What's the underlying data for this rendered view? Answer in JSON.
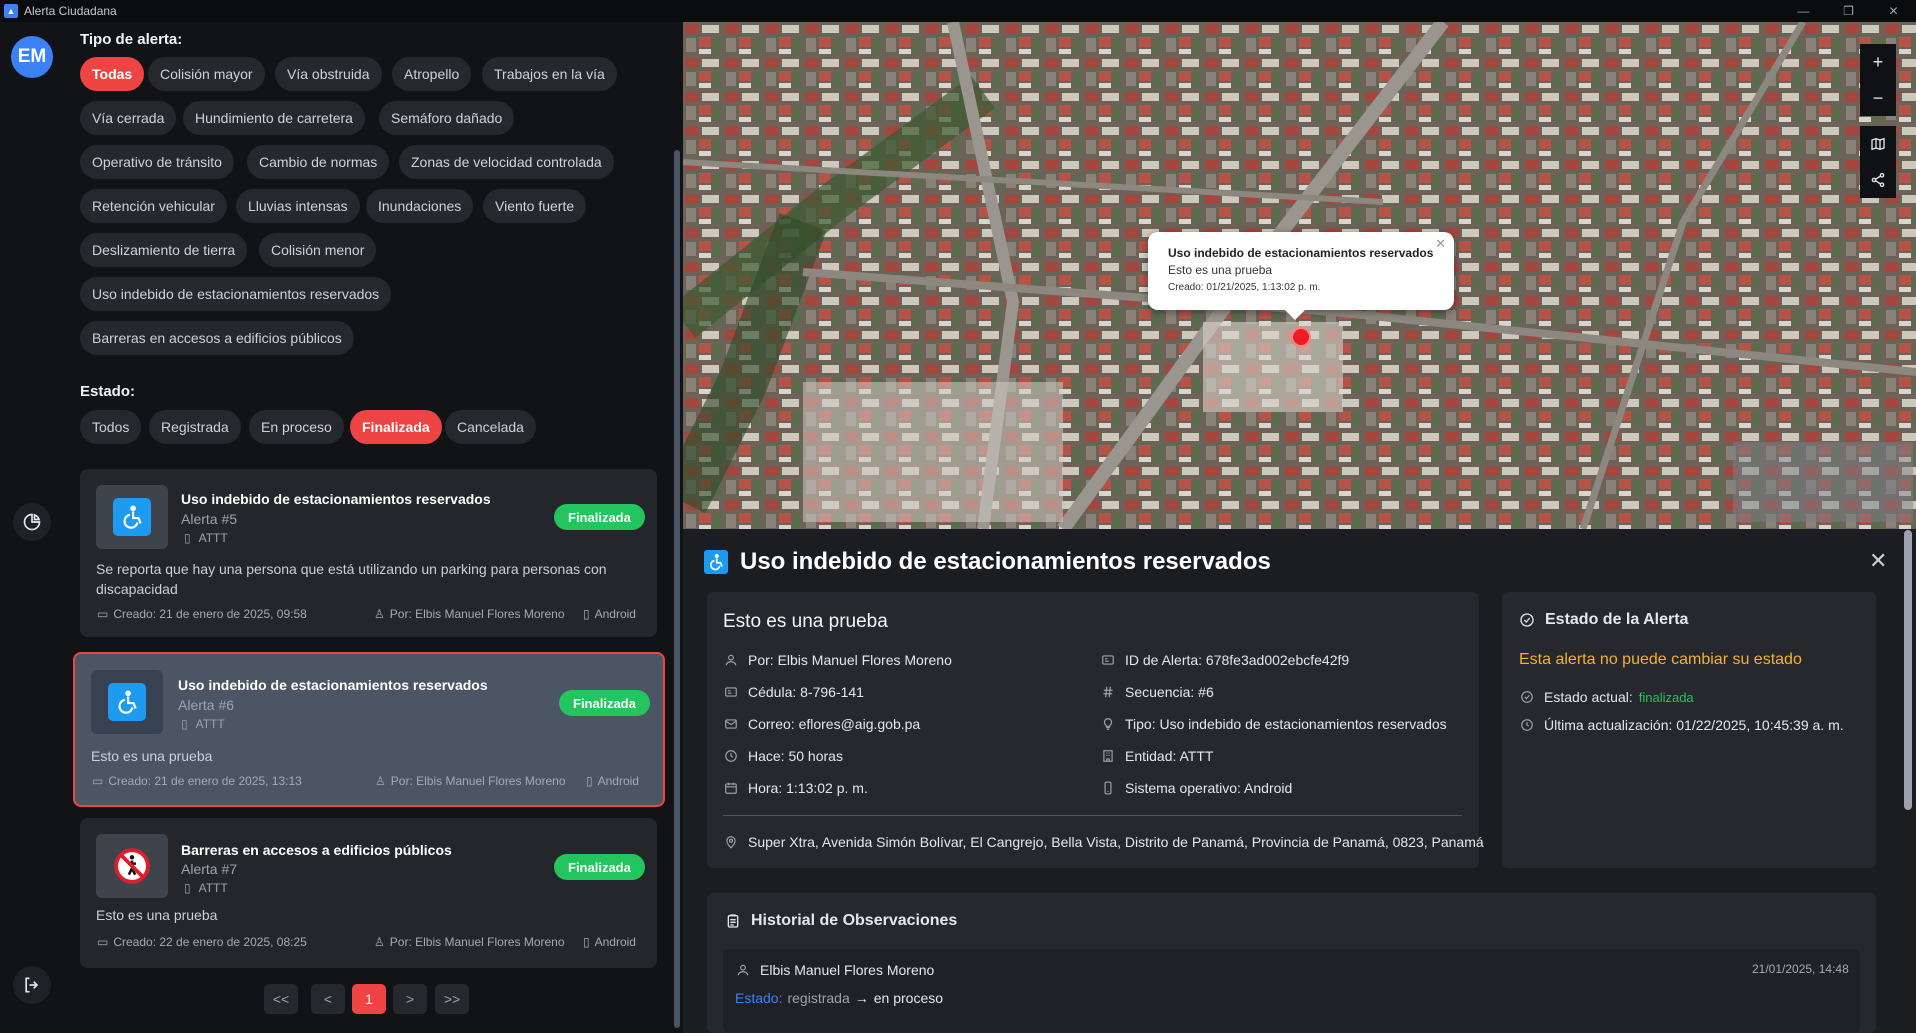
{
  "window": {
    "title": "Alerta Ciudadana",
    "minimize": "—",
    "restore": "❐",
    "close": "✕"
  },
  "user": {
    "initials": "EM"
  },
  "filters": {
    "type_label": "Tipo de alerta:",
    "types": [
      "Todas",
      "Colisión mayor",
      "Vía obstruida",
      "Atropello",
      "Trabajos en la vía",
      "Vía cerrada",
      "Hundimiento de carretera",
      "Semáforo dañado",
      "Operativo de tránsito",
      "Cambio de normas",
      "Zonas de velocidad controlada",
      "Retención vehicular",
      "Lluvias intensas",
      "Inundaciones",
      "Viento fuerte",
      "Deslizamiento de tierra",
      "Colisión menor",
      "Uso indebido de estacionamientos reservados",
      "Barreras en accesos a edificios públicos"
    ],
    "type_selected": "Todas",
    "state_label": "Estado:",
    "states": [
      "Todos",
      "Registrada",
      "En proceso",
      "Finalizada",
      "Cancelada"
    ],
    "state_selected": "Finalizada"
  },
  "alerts": [
    {
      "title": "Uso indebido de estacionamientos reservados",
      "number": "Alerta #5",
      "entity": "ATTT",
      "status": "Finalizada",
      "description": "Se reporta que hay una persona que está utilizando un parking para personas con discapacidad",
      "created": "Creado: 21 de enero de 2025, 09:58",
      "by": "Por: Elbis Manuel Flores Moreno",
      "os": "Android",
      "icon": "accessible-icon"
    },
    {
      "title": "Uso indebido de estacionamientos reservados",
      "number": "Alerta #6",
      "entity": "ATTT",
      "status": "Finalizada",
      "description": "Esto es una prueba",
      "created": "Creado: 21 de enero de 2025, 13:13",
      "by": "Por: Elbis Manuel Flores Moreno",
      "os": "Android",
      "icon": "accessible-icon"
    },
    {
      "title": "Barreras en accesos a edificios públicos",
      "number": "Alerta #7",
      "entity": "ATTT",
      "status": "Finalizada",
      "description": "Esto es una prueba",
      "created": "Creado: 22 de enero de 2025, 08:25",
      "by": "Por: Elbis Manuel Flores Moreno",
      "os": "Android",
      "icon": "no-pedestrian-icon"
    }
  ],
  "pagination": {
    "first": "<<",
    "prev": "<",
    "current": "1",
    "next": ">",
    "last": ">>"
  },
  "map": {
    "zoom_in": "+",
    "zoom_out": "−",
    "popup_title": "Uso indebido de estacionamientos reservados",
    "popup_desc": "Esto es una prueba",
    "popup_date": "Creado: 01/21/2025, 1:13:02 p. m.",
    "popup_close": "✕"
  },
  "detail": {
    "title": "Uso indebido de estacionamientos reservados",
    "close": "✕",
    "subtitle": "Esto es una prueba",
    "by": "Por: Elbis Manuel Flores Moreno",
    "cedula": "Cédula: 8-796-141",
    "email": "Correo: eflores@aig.gob.pa",
    "ago": "Hace: 50 horas",
    "time": "Hora: 1:13:02 p. m.",
    "alert_id": "ID de Alerta: 678fe3ad002ebcfe42f9",
    "sequence": "Secuencia: #6",
    "type": "Tipo: Uso indebido de estacionamientos reservados",
    "entity": "Entidad: ATTT",
    "os": "Sistema operativo: Android",
    "address": "Super Xtra, Avenida Simón Bolívar, El Cangrejo, Bella Vista, Distrito de Panamá, Provincia de Panamá, 0823, Panamá"
  },
  "status_panel": {
    "title": "Estado de la Alerta",
    "warning": "Esta alerta no puede cambiar su estado",
    "current_label": "Estado actual:",
    "current_value": "finalizada",
    "updated": "Última actualización: 01/22/2025, 10:45:39 a. m.",
    "warning_color": "#f5b02e",
    "ok_color": "#22c55e"
  },
  "history": {
    "title": "Historial de Observaciones",
    "entries": [
      {
        "user": "Elbis Manuel Flores Moreno",
        "date": "21/01/2025, 14:48",
        "state_label": "Estado:",
        "from": "registrada",
        "arrow": "→",
        "to": "en proceso"
      }
    ]
  },
  "colors": {
    "accent": "#ef4444",
    "success": "#22c55e",
    "link": "#3b82f6"
  }
}
